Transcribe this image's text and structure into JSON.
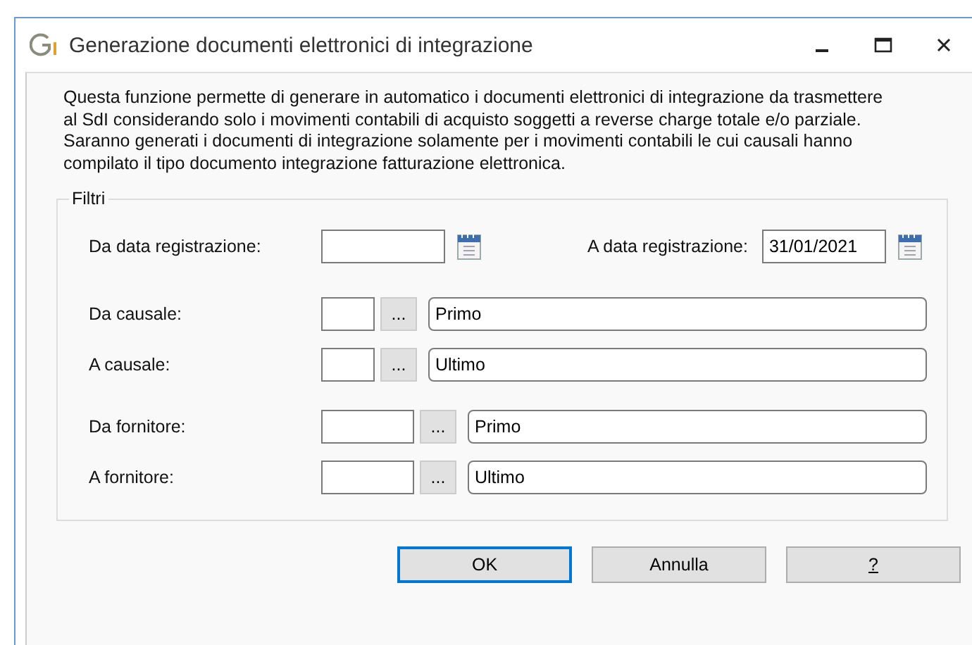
{
  "window": {
    "title": "Generazione documenti elettronici di integrazione"
  },
  "description": [
    "Questa funzione permette di generare in automatico i documenti elettronici di integrazione da trasmettere al SdI considerando solo i movimenti contabili di acquisto soggetti a reverse charge totale e/o parziale.",
    "Saranno generati i documenti di integrazione solamente per i movimenti contabili le cui causali hanno compilato il tipo documento integrazione fatturazione elettronica."
  ],
  "filters": {
    "legend": "Filtri",
    "dates": [
      {
        "label": "Da data registrazione:"
      },
      {
        "label": "A data registrazione:",
        "value": "31/01/2021"
      }
    ],
    "groups": [
      {
        "rows": [
          {
            "label": "Da causale:",
            "button": "...",
            "description": "Primo"
          },
          {
            "label": "A causale:",
            "button": "...",
            "description": "Ultimo"
          }
        ]
      },
      {
        "rows": [
          {
            "label": "Da fornitore:",
            "button": "...",
            "description": "Primo"
          },
          {
            "label": "A fornitore:",
            "button": "...",
            "description": "Ultimo"
          }
        ]
      }
    ]
  },
  "buttons": [
    {
      "label": "OK",
      "default": true,
      "mnemonic": false
    },
    {
      "label": "Annulla",
      "default": false,
      "mnemonic": false
    },
    {
      "label": "?",
      "default": false,
      "mnemonic": true
    }
  ]
}
